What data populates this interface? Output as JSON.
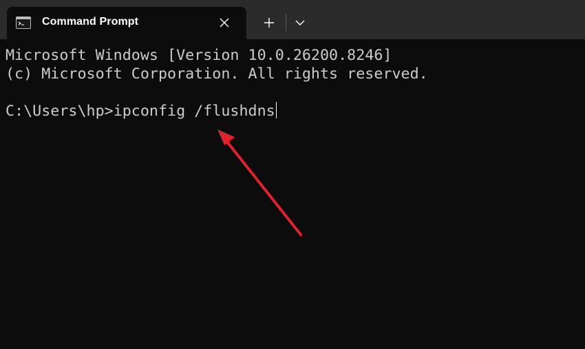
{
  "tab": {
    "title": "Command Prompt",
    "icon": "cmd-icon",
    "close_icon": "close-icon"
  },
  "toolbar": {
    "new_tab_icon": "plus-icon",
    "dropdown_icon": "chevron-down-icon"
  },
  "console": {
    "lines": [
      "Microsoft Windows [Version 10.0.26200.8246]",
      "(c) Microsoft Corporation. All rights reserved."
    ],
    "prompt": "C:\\Users\\hp>",
    "command": "ipconfig /flushdns"
  },
  "colors": {
    "tabbar_bg": "#2b2b2b",
    "console_bg": "#0c0c0c",
    "text": "#cccccc",
    "annotation_arrow": "#e0232a"
  }
}
